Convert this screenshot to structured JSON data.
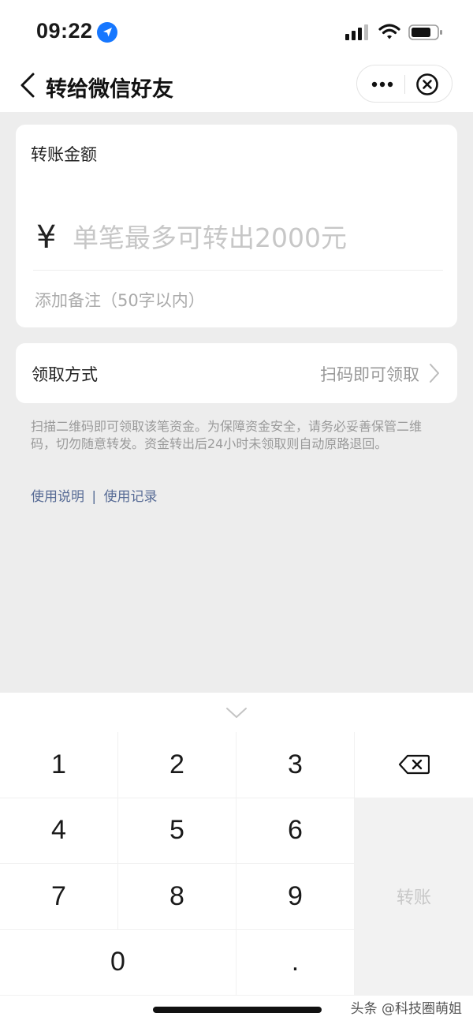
{
  "status_bar": {
    "time": "09:22",
    "icons": [
      "location-arrow-icon",
      "signal-icon",
      "wifi-icon",
      "battery-icon"
    ]
  },
  "nav": {
    "title": "转给微信好友",
    "back_icon": "chevron-left-icon",
    "more_icon": "more-dots-icon",
    "close_icon": "close-circle-icon"
  },
  "amount_card": {
    "label": "转账金额",
    "currency_symbol": "¥",
    "amount_placeholder": "单笔最多可转出2000元",
    "note_link": "添加备注（50字以内）"
  },
  "receive_card": {
    "label": "领取方式",
    "value": "扫码即可领取"
  },
  "hint": "扫描二维码即可领取该笔资金。为保障资金安全，请务必妥善保管二维码，切勿随意转发。资金转出后24小时未领取则自动原路退回。",
  "links": {
    "usage_instructions": "使用说明",
    "separator": "|",
    "usage_records": "使用记录",
    "color": "#576b95"
  },
  "keyboard": {
    "keys": [
      "1",
      "2",
      "3",
      "4",
      "5",
      "6",
      "7",
      "8",
      "9",
      "0",
      "."
    ],
    "transfer_label": "转账",
    "transfer_enabled": false
  },
  "watermark": "头条 @科技圈萌姐"
}
